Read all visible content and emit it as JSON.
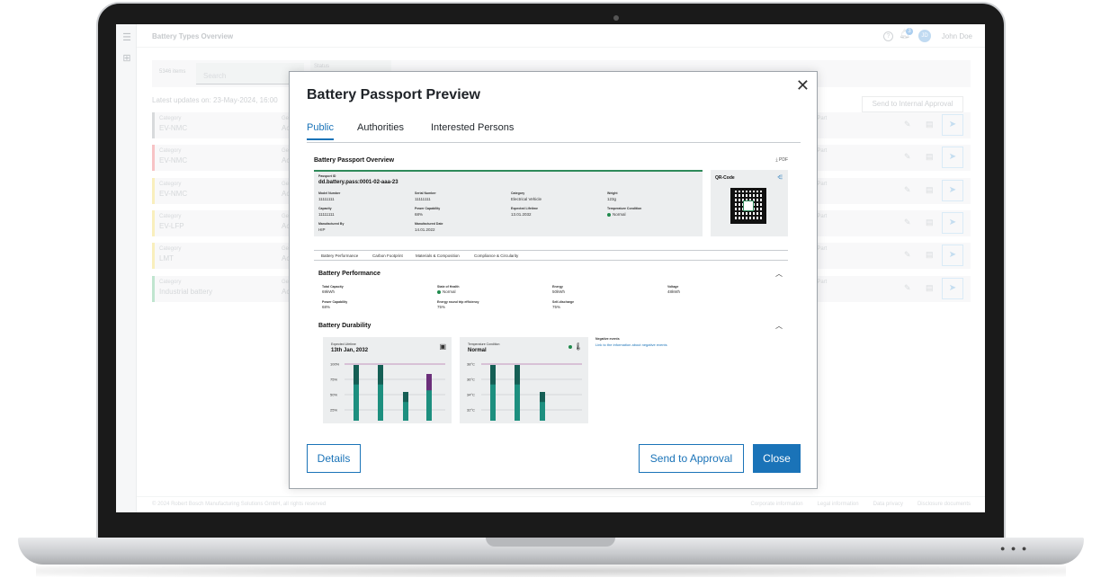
{
  "app": {
    "title": "Battery Types Overview",
    "notification_count": "3",
    "avatar_initials": "JD",
    "user_name": "John Doe",
    "help_icon": "?"
  },
  "toolbar": {
    "item_count": "5346 items",
    "search_placeholder": "Search",
    "status_label": "Status"
  },
  "updates_text": "Latest updates on: 23-May-2024, 16:00",
  "internal_approval_label": "Send to Internal Approval",
  "rows": [
    {
      "label": "Category",
      "value": "EV-NMC",
      "g_label": "Ge",
      "g_value": "Ac",
      "part": "al Part",
      "color": "#c4c6c9"
    },
    {
      "label": "Category",
      "value": "EV-NMC",
      "g_label": "Ge",
      "g_value": "Ac",
      "part": "al Part",
      "color": "#f3a3a6"
    },
    {
      "label": "Category",
      "value": "EV-NMC",
      "g_label": "Ge",
      "g_value": "Ac",
      "part": "al Part",
      "color": "#f6e79a"
    },
    {
      "label": "Category",
      "value": "EV-LFP",
      "g_label": "Ge",
      "g_value": "Ac",
      "part": "al Part",
      "color": "#f6e79a"
    },
    {
      "label": "Category",
      "value": "LMT",
      "g_label": "Ge",
      "g_value": "Ac",
      "part": "al Part",
      "color": "#f6e79a"
    },
    {
      "label": "Category",
      "value": "Industrial battery",
      "g_label": "Ge",
      "g_value": "Ac",
      "part": "al Part",
      "color": "#9fd8b6"
    }
  ],
  "footer": {
    "copyright": "© 2024 Robert Bosch Manufacturing Solutions GmbH, all rights reserved",
    "links": [
      "Corporate information",
      "Legal information",
      "Data privacy",
      "Disclosure documents"
    ]
  },
  "modal": {
    "title": "Battery Passport Preview",
    "tabs": [
      "Public",
      "Authorities",
      "Interested Persons"
    ],
    "overview_title": "Battery Passport Overview",
    "pdf_label": "PDF",
    "passport_id_label": "Passport ID",
    "passport_id": "dd.battery.pass:0001-02-aaa-23",
    "fields": [
      {
        "label": "Model Number",
        "value": "11111111"
      },
      {
        "label": "Serial Number",
        "value": "11111111"
      },
      {
        "label": "Category",
        "value": "Electrical Vehicle"
      },
      {
        "label": "Weight",
        "value": "123g"
      },
      {
        "label": "Capacity",
        "value": "11111111"
      },
      {
        "label": "Power Capability",
        "value": "68%"
      },
      {
        "label": "Expected Lifetime",
        "value": "13.01.2032"
      },
      {
        "label": "Temperature Condition",
        "value": "Normal"
      },
      {
        "label": "Manufactured By",
        "value": "HIP"
      },
      {
        "label": "Manufactured Date",
        "value": "14.01.2022"
      }
    ],
    "qr_title": "QR-Code",
    "subtabs": [
      "Battery Performance",
      "Carbon Footprint",
      "Materials & Composition",
      "Compliance & Circularity"
    ],
    "performance_title": "Battery Performance",
    "performance": [
      {
        "label": "Total Capacity",
        "value": "69kWh"
      },
      {
        "label": "State of Health",
        "value": "Normal"
      },
      {
        "label": "Energy",
        "value": "50kWh"
      },
      {
        "label": "Voltage",
        "value": "48kWh"
      },
      {
        "label": "Power Capability",
        "value": "68%"
      },
      {
        "label": "Energy round trip efficiency",
        "value": "75%"
      },
      {
        "label": "Self-discharge",
        "value": "75%"
      }
    ],
    "durability_title": "Battery Durability",
    "lifetime_card": {
      "label": "Expected Lifetime",
      "value": "13th Jan, 2032",
      "ticks": [
        "100%",
        "75%",
        "50%",
        "25%"
      ]
    },
    "temperature_card": {
      "label": "Temperature Condition",
      "value": "Normal",
      "ticks": [
        "38°C",
        "36°C",
        "34°C",
        "32°C"
      ]
    },
    "negative_label": "Negative events",
    "negative_link": "Link to the information about negative events",
    "buttons": {
      "details": "Details",
      "approval": "Send to Approval",
      "close": "Close"
    }
  },
  "colors": {
    "accent": "#1a73b8",
    "green": "#2f8a5a",
    "teal": "#1d8f7f"
  }
}
